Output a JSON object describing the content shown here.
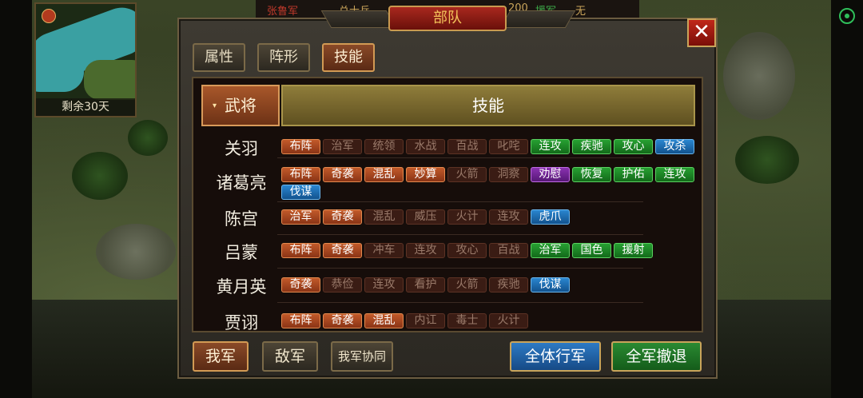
{
  "hud": {
    "top_left_text": "张鲁军",
    "top_mid_text": "总士兵",
    "top_num_text": "200",
    "top_green_text": "援军",
    "top_right_text": "无"
  },
  "minimap": {
    "days_left": "剩余30天"
  },
  "dialog": {
    "title": "部队",
    "close_glyph": "✕",
    "tabs": [
      "属性",
      "阵形",
      "技能"
    ],
    "active_tab": "技能",
    "header": {
      "general": "武将",
      "skill": "技能",
      "sort_arrow": "▾"
    },
    "rows": [
      {
        "name": "关羽",
        "skills": [
          {
            "t": "布阵",
            "c": "red"
          },
          {
            "t": "治军",
            "c": "dim"
          },
          {
            "t": "统领",
            "c": "dim"
          },
          {
            "t": "水战",
            "c": "dim"
          },
          {
            "t": "百战",
            "c": "dim"
          },
          {
            "t": "叱咤",
            "c": "dim"
          },
          {
            "t": "连攻",
            "c": "green"
          },
          {
            "t": "疾驰",
            "c": "green"
          },
          {
            "t": "攻心",
            "c": "green"
          },
          {
            "t": "攻杀",
            "c": "blue"
          }
        ]
      },
      {
        "name": "诸葛亮",
        "skills": [
          {
            "t": "布阵",
            "c": "red"
          },
          {
            "t": "奇袭",
            "c": "red"
          },
          {
            "t": "混乱",
            "c": "red"
          },
          {
            "t": "妙算",
            "c": "red"
          },
          {
            "t": "火箭",
            "c": "dim"
          },
          {
            "t": "洞察",
            "c": "dim"
          },
          {
            "t": "劝慰",
            "c": "purple"
          },
          {
            "t": "恢复",
            "c": "green"
          },
          {
            "t": "护佑",
            "c": "green"
          },
          {
            "t": "连攻",
            "c": "green"
          },
          {
            "t": "伐谋",
            "c": "blue"
          }
        ]
      },
      {
        "name": "陈宫",
        "skills": [
          {
            "t": "治军",
            "c": "red"
          },
          {
            "t": "奇袭",
            "c": "red"
          },
          {
            "t": "混乱",
            "c": "dim"
          },
          {
            "t": "威压",
            "c": "dim"
          },
          {
            "t": "火计",
            "c": "dim"
          },
          {
            "t": "连攻",
            "c": "dim"
          },
          {
            "t": "虎爪",
            "c": "blue"
          }
        ]
      },
      {
        "name": "吕蒙",
        "skills": [
          {
            "t": "布阵",
            "c": "red"
          },
          {
            "t": "奇袭",
            "c": "red"
          },
          {
            "t": "冲车",
            "c": "dim"
          },
          {
            "t": "连攻",
            "c": "dim"
          },
          {
            "t": "攻心",
            "c": "dim"
          },
          {
            "t": "百战",
            "c": "dim"
          },
          {
            "t": "治军",
            "c": "green"
          },
          {
            "t": "国色",
            "c": "green"
          },
          {
            "t": "援射",
            "c": "green"
          }
        ]
      },
      {
        "name": "黄月英",
        "skills": [
          {
            "t": "奇袭",
            "c": "red"
          },
          {
            "t": "恭俭",
            "c": "dim"
          },
          {
            "t": "连攻",
            "c": "dim"
          },
          {
            "t": "看护",
            "c": "dim"
          },
          {
            "t": "火箭",
            "c": "dim"
          },
          {
            "t": "疾驰",
            "c": "dim"
          },
          {
            "t": "伐谋",
            "c": "blue"
          }
        ]
      },
      {
        "name": "贾诩",
        "skills": [
          {
            "t": "布阵",
            "c": "red"
          },
          {
            "t": "奇袭",
            "c": "red"
          },
          {
            "t": "混乱",
            "c": "red"
          },
          {
            "t": "内讧",
            "c": "dim"
          },
          {
            "t": "毒士",
            "c": "dim"
          },
          {
            "t": "火计",
            "c": "dim"
          }
        ]
      }
    ],
    "bottom": {
      "my_army": "我军",
      "enemy_army": "敌军",
      "coop": "我军协同",
      "all_march": "全体行军",
      "all_retreat": "全军撤退"
    }
  },
  "colors": {
    "skill_red": "#c25a2a",
    "skill_dim": "#3a1c14",
    "skill_green": "#27a032",
    "skill_blue": "#2a86d0",
    "skill_purple": "#8a32b0",
    "title_red": "#a8281e",
    "gold": "#f3c25a"
  }
}
